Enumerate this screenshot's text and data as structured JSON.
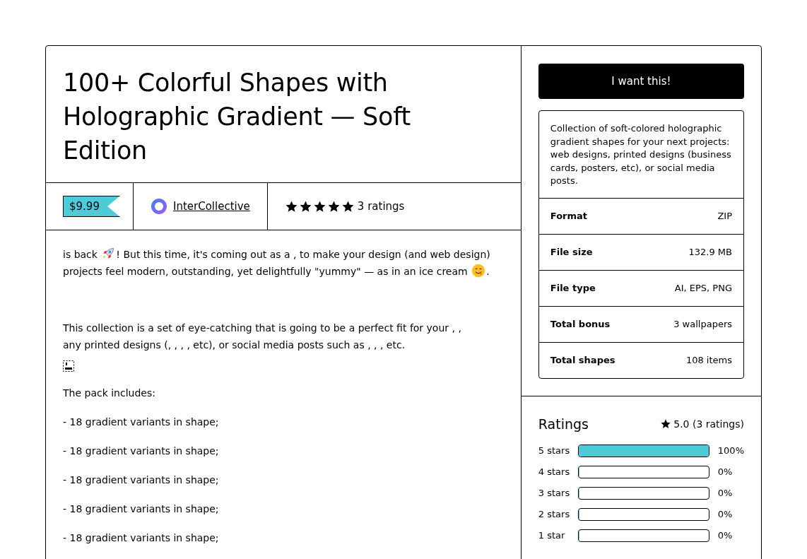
{
  "title": "100+ Colorful Shapes with Holographic Gradient — Soft Edition",
  "price": "$9.99",
  "creator": {
    "name": "InterCollective"
  },
  "rating_summary": {
    "stars": 5,
    "count": "3 ratings"
  },
  "description": {
    "intro": {
      "start": " is back ",
      "middle": "! But this time, it's coming out as a , to make your design (and web design) projects feel modern, outstanding, yet delightfully \"yummy\" — as in an ice cream ",
      "end": "."
    },
    "collection": "This collection is a set of eye-catching that is going to be a perfect fit for your , , any printed designs (, , , , etc), or social media posts such as , , , etc.",
    "pack_heading": "The pack includes:",
    "pack_items": [
      "- 18 gradient variants in  shape;",
      "- 18 gradient variants in  shape;",
      "- 18 gradient variants in  shape;",
      "- 18 gradient variants in  shape;",
      "- 18 gradient variants in  shape;"
    ]
  },
  "buy_button": "I want this!",
  "summary": "Collection of soft-colored holographic gradient shapes for your next projects: web designs, printed designs (business cards, posters, etc), or social media posts.",
  "details": [
    {
      "label": "Format",
      "value": "ZIP"
    },
    {
      "label": "File size",
      "value": "132.9 MB"
    },
    {
      "label": "File type",
      "value": "AI, EPS, PNG"
    },
    {
      "label": "Total bonus",
      "value": "3 wallpapers"
    },
    {
      "label": "Total shapes",
      "value": "108 items"
    }
  ],
  "ratings": {
    "heading": "Ratings",
    "average": "5.0 (3 ratings)",
    "rows": [
      {
        "label": "5 stars",
        "level": 1,
        "percent": "100%"
      },
      {
        "label": "4 stars",
        "level": 0,
        "percent": "0%"
      },
      {
        "label": "3 stars",
        "level": 0,
        "percent": "0%"
      },
      {
        "label": "2 stars",
        "level": 0,
        "percent": "0%"
      },
      {
        "label": "1 star",
        "level": 0,
        "percent": "0%"
      }
    ]
  }
}
